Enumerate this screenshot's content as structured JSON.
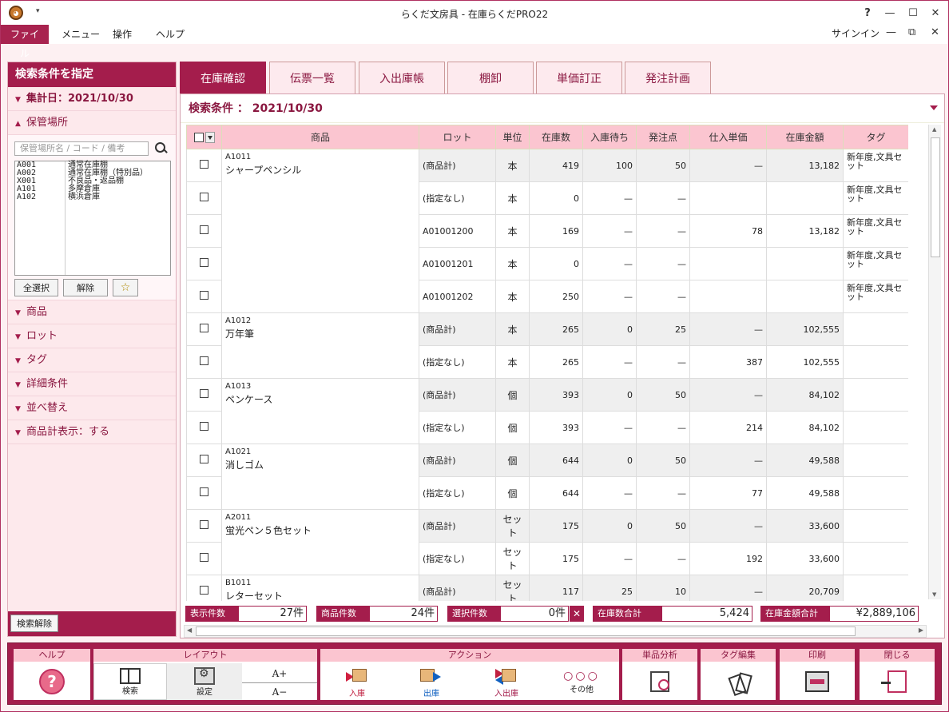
{
  "window": {
    "title": "らくだ文房具 - 在庫らくだPRO22",
    "help_btn": "?",
    "min_btn": "—",
    "max_btn": "☐",
    "close_btn": "✕",
    "signin": "サインイン",
    "sub_min": "—",
    "sub_restore": "⧉",
    "sub_close": "✕"
  },
  "menu": [
    "ファイル",
    "メニュー",
    "操作",
    "ヘルプ"
  ],
  "left": {
    "header": "検索条件を指定",
    "date_section": "集計日：2021/10/30",
    "location_section": "保管場所",
    "location_placeholder": "保管場所名 / コード / 備考",
    "locations": [
      {
        "code": "A001",
        "name": "通常在庫棚"
      },
      {
        "code": "A002",
        "name": "通常在庫棚（特別品）"
      },
      {
        "code": "X001",
        "name": "不良品・返品棚"
      },
      {
        "code": "A101",
        "name": "多摩倉庫"
      },
      {
        "code": "A102",
        "name": "横浜倉庫"
      }
    ],
    "select_all": "全選択",
    "release": "解除",
    "star": "☆",
    "sections": [
      "商品",
      "ロット",
      "タグ",
      "詳細条件",
      "並べ替え",
      "商品計表示：する"
    ],
    "clear": "検索解除"
  },
  "tabs": [
    "在庫確認",
    "伝票一覧",
    "入出庫帳",
    "棚卸",
    "単価訂正",
    "発注計画"
  ],
  "condition": "検索条件 ： 2021/10/30",
  "table": {
    "headers": [
      "商品",
      "ロット",
      "単位",
      "在庫数",
      "入庫待ち",
      "発注点",
      "仕入単価",
      "在庫金額",
      "タグ"
    ],
    "groups": [
      {
        "code": "A1011",
        "name": "シャープペンシル",
        "rows": [
          {
            "sum": true,
            "lot": "(商品計)",
            "unit": "本",
            "qty": "419",
            "wait": "100",
            "order": "50",
            "price": "—",
            "amount": "13,182",
            "tag": "新年度,文具セット"
          },
          {
            "sum": false,
            "lot": "(指定なし)",
            "unit": "本",
            "qty": "0",
            "wait": "—",
            "order": "—",
            "price": "",
            "amount": "",
            "tag": "新年度,文具セット"
          },
          {
            "sum": false,
            "lot": "A01001200",
            "unit": "本",
            "qty": "169",
            "wait": "—",
            "order": "—",
            "price": "78",
            "amount": "13,182",
            "tag": "新年度,文具セット"
          },
          {
            "sum": false,
            "lot": "A01001201",
            "unit": "本",
            "qty": "0",
            "wait": "—",
            "order": "—",
            "price": "",
            "amount": "",
            "tag": "新年度,文具セット"
          },
          {
            "sum": false,
            "lot": "A01001202",
            "unit": "本",
            "qty": "250",
            "wait": "—",
            "order": "—",
            "price": "",
            "amount": "",
            "tag": "新年度,文具セット"
          }
        ]
      },
      {
        "code": "A1012",
        "name": "万年筆",
        "rows": [
          {
            "sum": true,
            "lot": "(商品計)",
            "unit": "本",
            "qty": "265",
            "wait": "0",
            "order": "25",
            "price": "—",
            "amount": "102,555",
            "tag": ""
          },
          {
            "sum": false,
            "lot": "(指定なし)",
            "unit": "本",
            "qty": "265",
            "wait": "—",
            "order": "—",
            "price": "387",
            "amount": "102,555",
            "tag": ""
          }
        ]
      },
      {
        "code": "A1013",
        "name": "ペンケース",
        "rows": [
          {
            "sum": true,
            "lot": "(商品計)",
            "unit": "個",
            "qty": "393",
            "wait": "0",
            "order": "50",
            "price": "—",
            "amount": "84,102",
            "tag": ""
          },
          {
            "sum": false,
            "lot": "(指定なし)",
            "unit": "個",
            "qty": "393",
            "wait": "—",
            "order": "—",
            "price": "214",
            "amount": "84,102",
            "tag": ""
          }
        ]
      },
      {
        "code": "A1021",
        "name": "消しゴム",
        "rows": [
          {
            "sum": true,
            "lot": "(商品計)",
            "unit": "個",
            "qty": "644",
            "wait": "0",
            "order": "50",
            "price": "—",
            "amount": "49,588",
            "tag": ""
          },
          {
            "sum": false,
            "lot": "(指定なし)",
            "unit": "個",
            "qty": "644",
            "wait": "—",
            "order": "—",
            "price": "77",
            "amount": "49,588",
            "tag": ""
          }
        ]
      },
      {
        "code": "A2011",
        "name": "蛍光ペン５色セット",
        "rows": [
          {
            "sum": true,
            "lot": "(商品計)",
            "unit": "セット",
            "qty": "175",
            "wait": "0",
            "order": "50",
            "price": "—",
            "amount": "33,600",
            "tag": ""
          },
          {
            "sum": false,
            "lot": "(指定なし)",
            "unit": "セット",
            "qty": "175",
            "wait": "—",
            "order": "—",
            "price": "192",
            "amount": "33,600",
            "tag": ""
          }
        ]
      },
      {
        "code": "B1011",
        "name": "レターセット",
        "rows": [
          {
            "sum": true,
            "lot": "(商品計)",
            "unit": "セット",
            "qty": "117",
            "wait": "25",
            "order": "10",
            "price": "—",
            "amount": "20,709",
            "tag": ""
          }
        ]
      }
    ]
  },
  "stats": {
    "display_label": "表示件数",
    "display_val": "27件",
    "product_label": "商品件数",
    "product_val": "24件",
    "select_label": "選択件数",
    "select_val": "0件",
    "x": "✕",
    "stock_label": "在庫数合計",
    "stock_val": "5,424",
    "amount_label": "在庫金額合計",
    "amount_val": "¥2,889,106"
  },
  "toolbar": {
    "help": "ヘルプ",
    "layout": "レイアウト",
    "action": "アクション",
    "analysis": "単品分析",
    "tag_edit": "タグ編集",
    "print": "印刷",
    "close": "閉じる",
    "search": "検索",
    "settings": "設定",
    "font_up": "A+",
    "font_down": "A−",
    "in": "入庫",
    "out": "出庫",
    "inout": "入出庫",
    "other": "その他",
    "dots": "○○○",
    "q": "?"
  },
  "colors": {
    "accent": "#a41d4c",
    "header_pink": "#fbc5d0",
    "panel_bg": "#fde9ec"
  }
}
